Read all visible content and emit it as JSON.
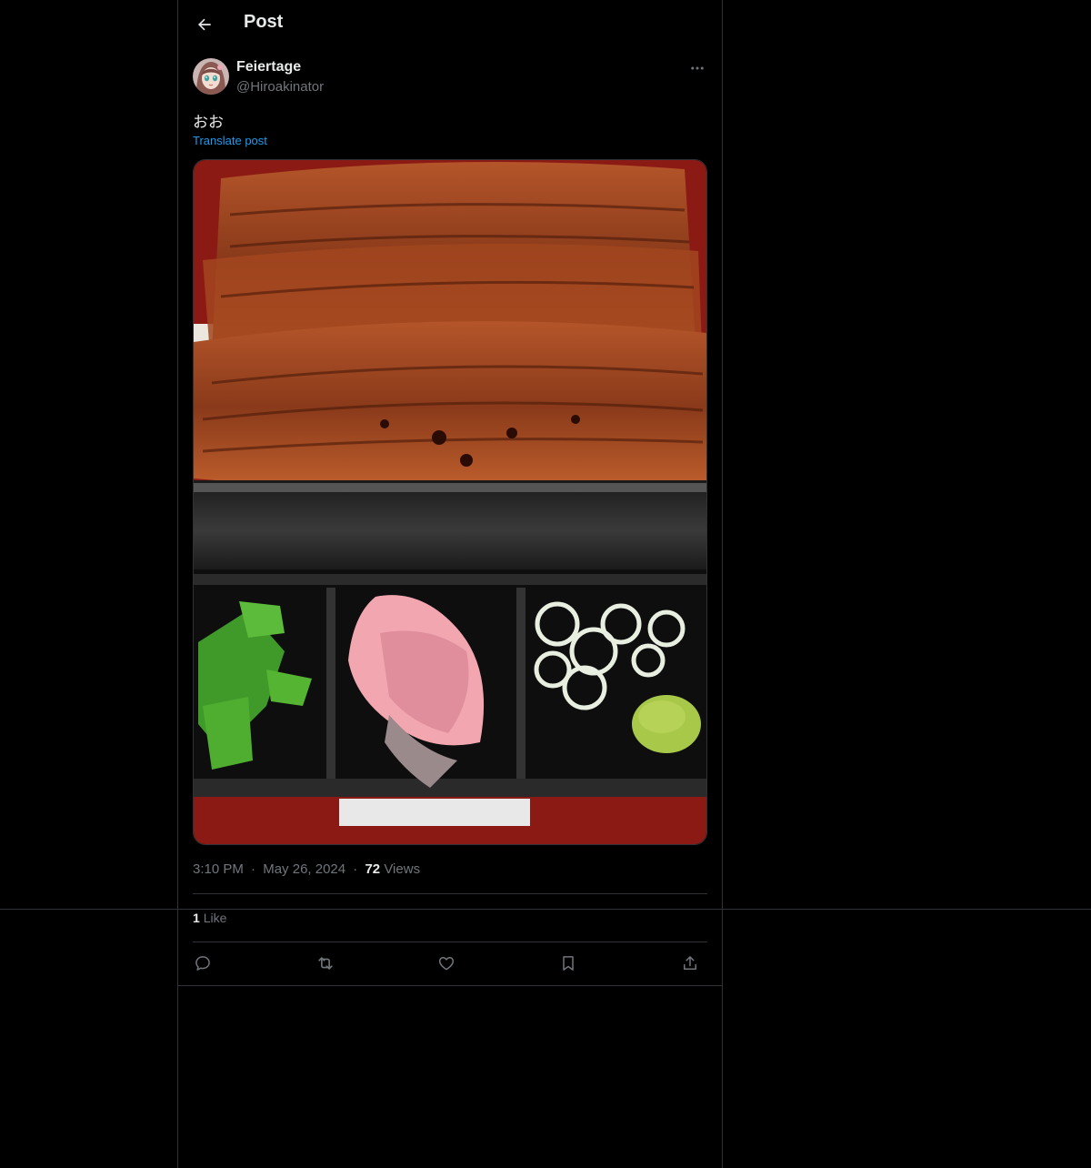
{
  "header": {
    "title": "Post",
    "back_icon": "arrow-left-icon"
  },
  "post": {
    "author": {
      "display_name": "Feiertage",
      "handle": "@Hiroakinator",
      "avatar": "anime-avatar"
    },
    "more_icon": "more-horizontal-icon",
    "text": "おお",
    "translate_label": "Translate post",
    "media": {
      "description_icon": "photo"
    },
    "time": "3:10 PM",
    "date": "May 26, 2024",
    "separator": "·",
    "views_count": "72",
    "views_label": "Views",
    "likes_count": "1",
    "likes_label": "Like"
  },
  "actions": [
    {
      "name": "reply",
      "icon": "comment-icon"
    },
    {
      "name": "repost",
      "icon": "repost-icon"
    },
    {
      "name": "like",
      "icon": "heart-icon"
    },
    {
      "name": "bookmark",
      "icon": "bookmark-icon"
    },
    {
      "name": "share",
      "icon": "share-icon"
    }
  ],
  "colors": {
    "background": "#000000",
    "text": "#e7e9ea",
    "secondary": "#71767b",
    "link": "#1d9bf0",
    "border": "#2f3336"
  }
}
